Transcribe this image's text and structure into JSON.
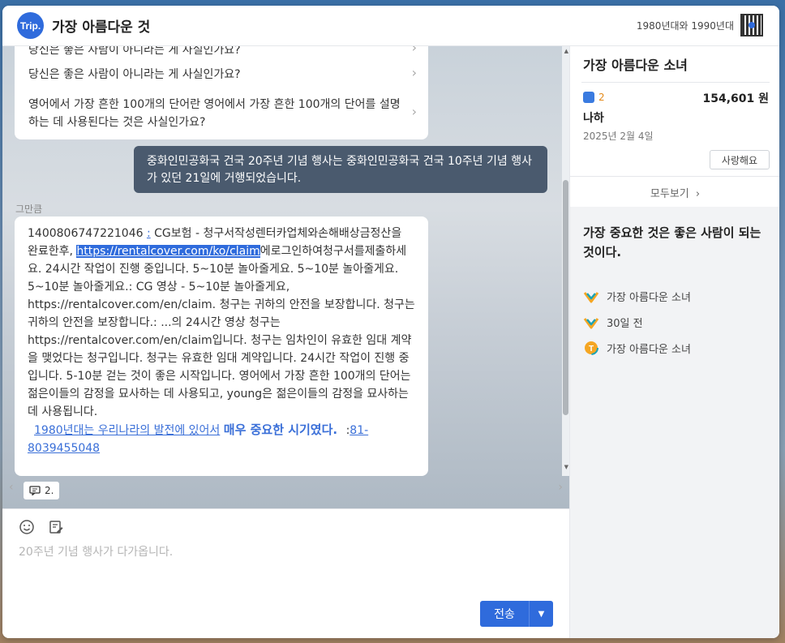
{
  "header": {
    "logo_text": "Trip.",
    "title": "가장 아름다운 것",
    "right_text": "1980년대와 1990년대"
  },
  "faq": {
    "items": [
      {
        "label": "당신은 좋은 사람이 아니라는 게 사실인가요?"
      },
      {
        "label": "당신은 좋은 사람이 아니라는 게 사실인가요?"
      },
      {
        "label": "영어에서 가장 흔한 100개의 단어란 영어에서 가장 흔한 100개의 단어를 설명하는 데 사용된다는 것은 사실인가요?"
      }
    ]
  },
  "outgoing": {
    "text": "중화인민공화국 건국 20주년 기념 행사는 중화인민공화국 건국 10주년 기념 행사가 있던 21일에 거행되었습니다."
  },
  "incoming": {
    "sender": "그만큼",
    "id": "1400806747221046",
    "colon": ":",
    "part1": " CG보험 - 청구서작성렌터카업체와손해배상금정산을 완료한후, ",
    "url_highlight": "https://rentalcover.com/ko/claim",
    "part2": "에로그인하여청구서를제출하세요. 24시간 작업이 진행 중입니다. 5~10분 놀아줄게요. 5~10분 놀아줄게요. 5~10분 놀아줄게요.: CG 영상 - 5~10분 놀아줄게요, https://rentalcover.com/en/claim. 청구는 귀하의 안전을 보장합니다. 청구는 귀하의 안전을 보장합니다.: ...의 24시간 영상 청구는 https://rentalcover.com/en/claim입니다. 청구는 임차인이 유효한 임대 계약을 맺었다는 청구입니다. 청구는 유효한 임대 계약입니다. 24시간 작업이 진행 중입니다. 5-10분 걷는 것이 좋은 시작입니다. 영어에서 가장 흔한 100개의 단어는 젊은이들의 감정을 묘사하는 데 사용되고, young은 젊은이들의 감정을 묘사하는 데 사용됩니다.",
    "link_small": "1980년대는 우리나라의 발전에 있어서",
    "link_big": "매우 중요한 시기였다.",
    "phone_prefix": ":",
    "phone": "81-8039455048"
  },
  "footer": {
    "page_label": "2."
  },
  "input": {
    "placeholder": "20주년 기념 행사가 다가옵니다.",
    "send_label": "전송"
  },
  "right_panel": {
    "card_title": "가장 아름다운 소녀",
    "badge_count": "2",
    "price": "154,601 원",
    "name": "나하",
    "date": "2025년 2월 4일",
    "like_label": "사랑해요",
    "more_label": "모두보기",
    "heading": "가장 중요한 것은 좋은 사람이 되는 것이다.",
    "list": [
      {
        "label": "가장 아름다운 소녀",
        "icon": "check-heart-icon"
      },
      {
        "label": "30일 전",
        "icon": "check-heart-icon"
      },
      {
        "label": "가장 아름다운 소녀",
        "icon": "coin-icon"
      }
    ],
    "accent": "#2f6bdc"
  }
}
